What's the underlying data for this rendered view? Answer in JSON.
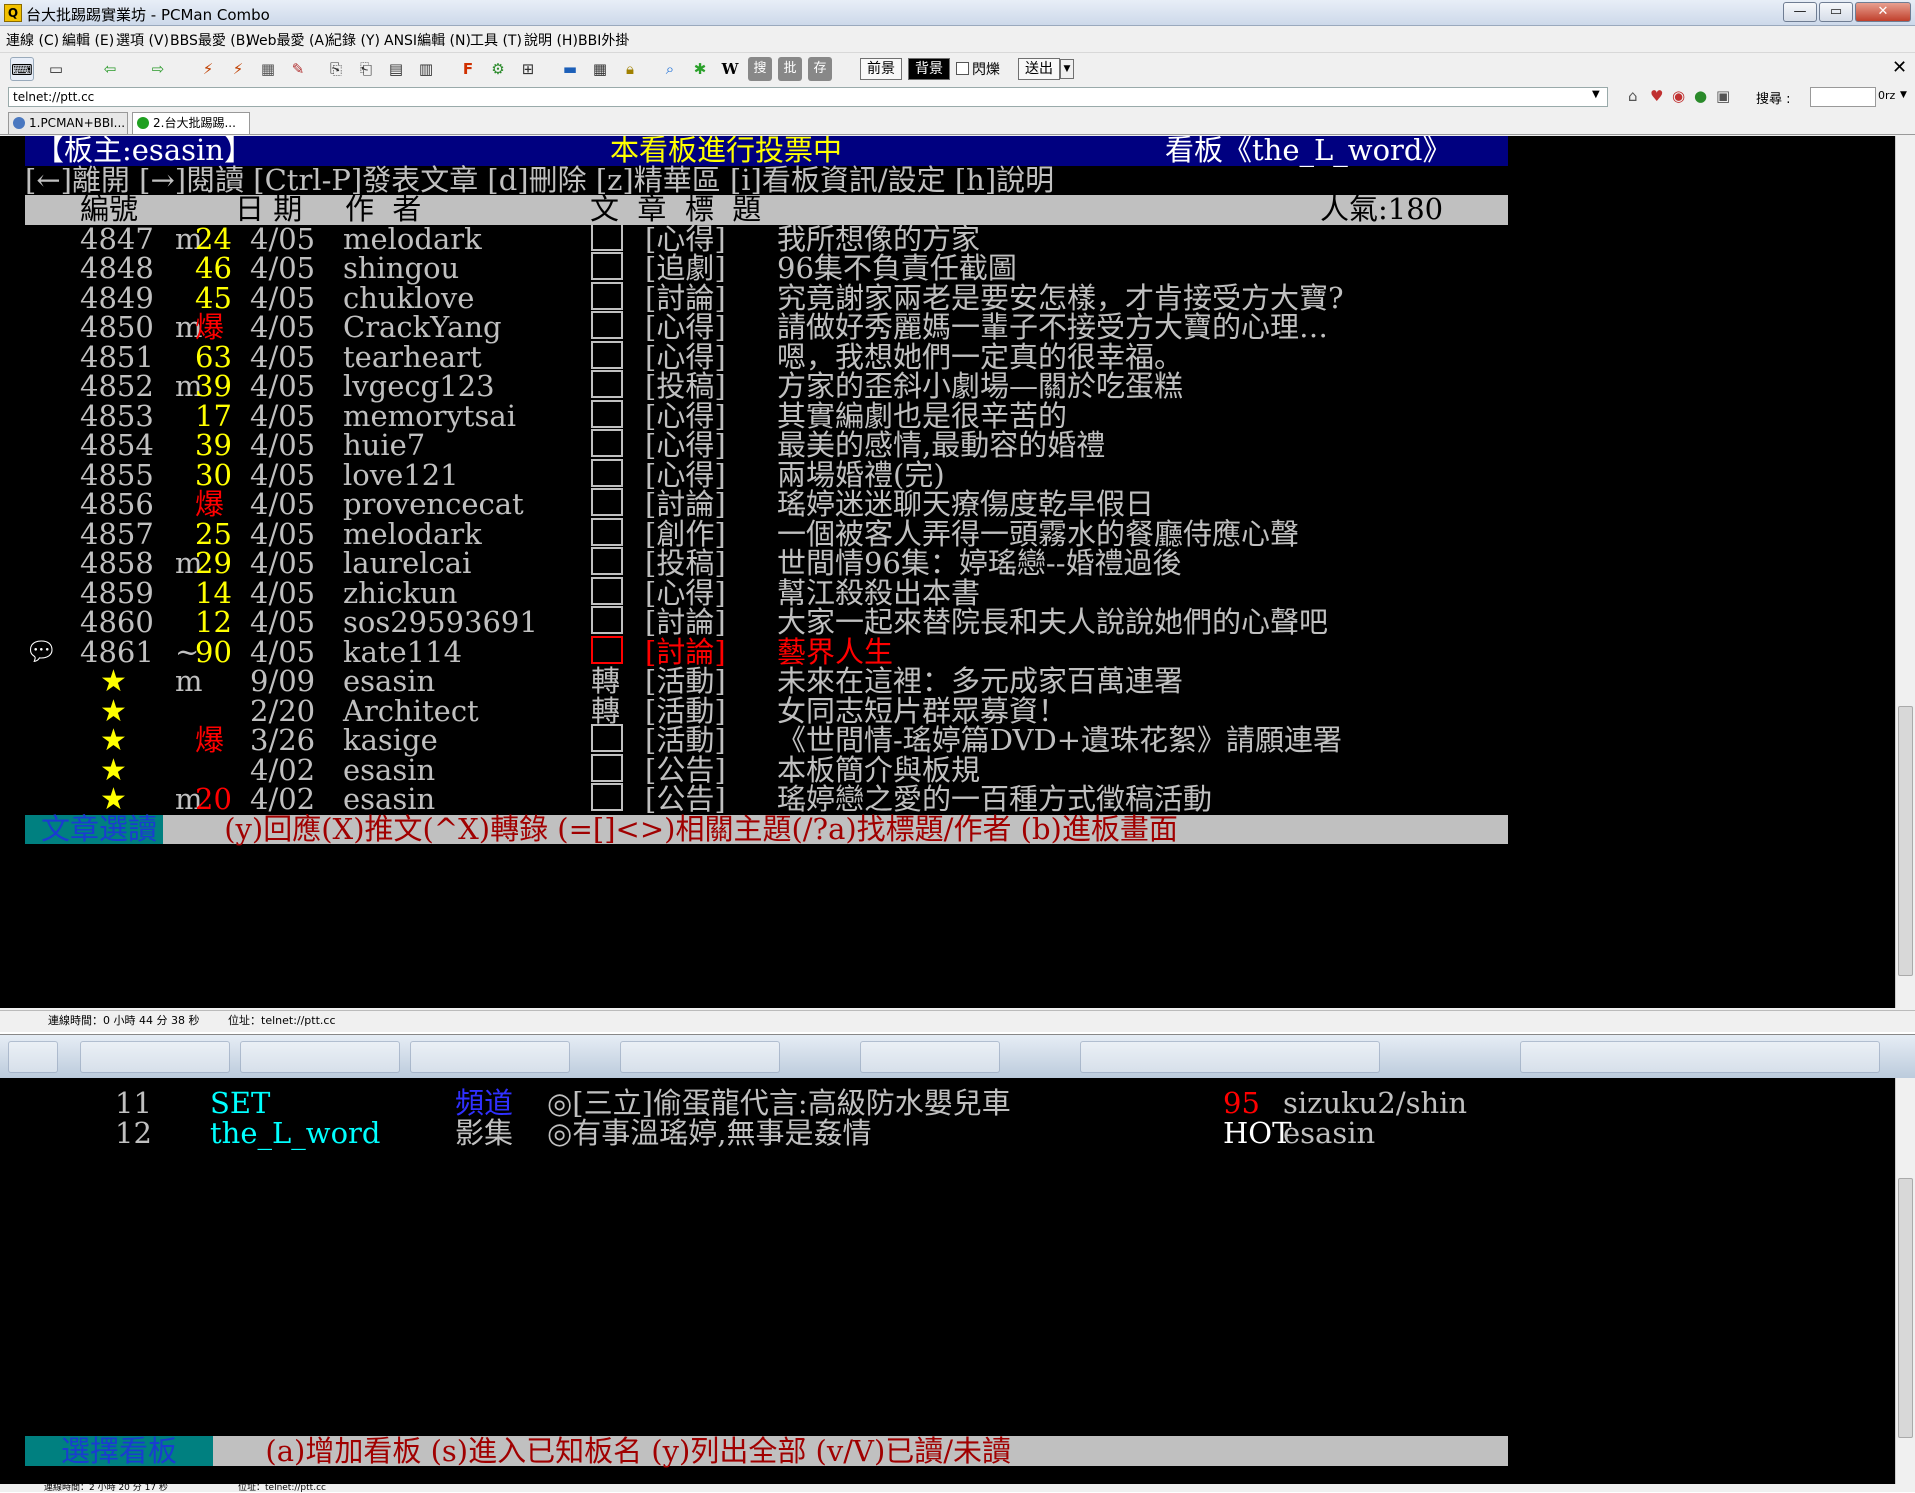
{
  "window": {
    "title": "台大批踢踢實業坊 - PCMan Combo",
    "icon_letter": "Q",
    "minimize": "—",
    "maximize": "▭",
    "close": "✕"
  },
  "menu": [
    "連線 (C)",
    "編輯 (E)",
    "選項 (V)",
    "BBS最愛 (B)",
    "Web最愛 (A)",
    "紀錄 (Y)",
    "ANSI編輯 (N)",
    "工具 (T)",
    "說明 (H)",
    "BBI外掛"
  ],
  "toolbar": {
    "fg_label": "前景",
    "bg_label": "背景",
    "blink_label": "閃爍",
    "send_label": "送出",
    "wiki_label": "W",
    "search_btn": "搜",
    "ptt_btn": "批",
    "save_btn": "存"
  },
  "address": {
    "url": "telnet://ptt.cc",
    "search_label": "搜尋 :",
    "search_value": "",
    "search_engine": "0rz"
  },
  "tabs": [
    {
      "label": "1.PCMAN+BBI...",
      "color": "#4a78c0"
    },
    {
      "label": "2.台大批踢踢...",
      "color": "#1fa020"
    }
  ],
  "board": {
    "header": {
      "moderator": "【板主:esasin】",
      "center": "本看板進行投票中",
      "board": "看板《the_L_word》"
    },
    "help": "[←]離開 [→]閱讀 [Ctrl-P]發表文章 [d]刪除 [z]精華區 [i]看板資訊/設定 [h]說明",
    "columns": {
      "num": "編號",
      "date": "日 期",
      "author": "作  者",
      "title": "文  章  標  題",
      "popularity": "人氣:180"
    },
    "posts": [
      {
        "num": "4847",
        "mark": "m",
        "score": "24",
        "date": "4/05",
        "author": "melodark",
        "flag": "box",
        "cat": "[心得]",
        "title": "我所想像的方家"
      },
      {
        "num": "4848",
        "mark": " ",
        "score": "46",
        "date": "4/05",
        "author": "shingou",
        "flag": "box",
        "cat": "[追劇]",
        "title": "96集不負責任截圖"
      },
      {
        "num": "4849",
        "mark": " ",
        "score": "45",
        "date": "4/05",
        "author": "chuklove",
        "flag": "box",
        "cat": "[討論]",
        "title": "究竟謝家兩老是要安怎樣，才肯接受方大寶?"
      },
      {
        "num": "4850",
        "mark": "m",
        "score": "爆",
        "date": "4/05",
        "author": "CrackYang",
        "flag": "box",
        "cat": "[心得]",
        "title": "請做好秀麗媽一輩子不接受方大寶的心理…"
      },
      {
        "num": "4851",
        "mark": " ",
        "score": "63",
        "date": "4/05",
        "author": "tearheart",
        "flag": "box",
        "cat": "[心得]",
        "title": "嗯，我想她們一定真的很幸福。"
      },
      {
        "num": "4852",
        "mark": "m",
        "score": "39",
        "date": "4/05",
        "author": "lvgecg123",
        "flag": "box",
        "cat": "[投稿]",
        "title": "方家的歪斜小劇場—關於吃蛋糕"
      },
      {
        "num": "4853",
        "mark": " ",
        "score": "17",
        "date": "4/05",
        "author": "memorytsai",
        "flag": "box",
        "cat": "[心得]",
        "title": "其實編劇也是很辛苦的"
      },
      {
        "num": "4854",
        "mark": " ",
        "score": "39",
        "date": "4/05",
        "author": "huie7",
        "flag": "box",
        "cat": "[心得]",
        "title": "最美的感情,最動容的婚禮"
      },
      {
        "num": "4855",
        "mark": " ",
        "score": "30",
        "date": "4/05",
        "author": "love121",
        "flag": "box",
        "cat": "[心得]",
        "title": "兩場婚禮(完)"
      },
      {
        "num": "4856",
        "mark": " ",
        "score": "爆",
        "date": "4/05",
        "author": "provencecat",
        "flag": "box",
        "cat": "[討論]",
        "title": "瑤婷迷迷聊天療傷度乾旱假日"
      },
      {
        "num": "4857",
        "mark": " ",
        "score": "25",
        "date": "4/05",
        "author": "melodark",
        "flag": "box",
        "cat": "[創作]",
        "title": "一個被客人弄得一頭霧水的餐廳侍應心聲"
      },
      {
        "num": "4858",
        "mark": "m",
        "score": "29",
        "date": "4/05",
        "author": "laurelcai",
        "flag": "box",
        "cat": "[投稿]",
        "title": "世間情96集：婷瑤戀--婚禮過後"
      },
      {
        "num": "4859",
        "mark": " ",
        "score": "14",
        "date": "4/05",
        "author": "zhickun",
        "flag": "box",
        "cat": "[心得]",
        "title": "幫江殺殺出本書"
      },
      {
        "num": "4860",
        "mark": " ",
        "score": "12",
        "date": "4/05",
        "author": "sos29593691",
        "flag": "box",
        "cat": "[討論]",
        "title": "大家一起來替院長和夫人說說她們的心聲吧"
      },
      {
        "num": "4861",
        "mark": "~",
        "score": "90",
        "date": "4/05",
        "author": "kate114",
        "flag": "box",
        "cat": "[討論]",
        "title": "藝界人生"
      }
    ],
    "pinned": [
      {
        "mark": "m",
        "score": "",
        "date": "9/09",
        "author": "esasin",
        "flag": "轉",
        "cat": "[活動]",
        "title": "未來在這裡：多元成家百萬連署"
      },
      {
        "mark": " ",
        "score": "",
        "date": "2/20",
        "author": "Architect",
        "flag": "轉",
        "cat": "[活動]",
        "title": "女同志短片群眾募資！"
      },
      {
        "mark": " ",
        "score": "爆",
        "date": "3/26",
        "author": "kasige",
        "flag": "box",
        "cat": "[活動]",
        "title": "《世間情-瑤婷篇DVD+遺珠花絮》請願連署"
      },
      {
        "mark": " ",
        "score": "",
        "date": "4/02",
        "author": "esasin",
        "flag": "box",
        "cat": "[公告]",
        "title": "本板簡介與板規"
      },
      {
        "mark": "m",
        "score": "20",
        "date": "4/02",
        "author": "esasin",
        "flag": "box",
        "cat": "[公告]",
        "title": "瑤婷戀之愛的一百種方式徵稿活動"
      }
    ],
    "star_char": "★",
    "footer_mode": "文章選讀",
    "footer_help": " (y)回應(X)推文(^X)轉錄 (=[]<>)相關主題(/?a)找標題/作者 (b)進板畫面"
  },
  "status1": {
    "connected": "連線時間：0 小時 44 分 38 秒",
    "address": "位址：telnet://ptt.cc"
  },
  "boardlist": {
    "rows": [
      {
        "num": "11",
        "name": "SET",
        "cls": "頻道",
        "desc": "◎[三立]偷蛋龍代言:高級防水嬰兒車",
        "pop": "95",
        "mods": "sizuku2/shin"
      },
      {
        "num": "12",
        "name": "the_L_word",
        "cls": "影集",
        "desc": "◎有事溫瑤婷,無事是姦情",
        "pop": "HOT",
        "mods": "esasin"
      }
    ],
    "footer_mode": "選擇看板",
    "footer_help": "  (a)增加看板 (s)進入已知板名 (y)列出全部 (v/V)已讀/未讀"
  },
  "status2": {
    "connected": "連線時間：2 小時 20 分 17 秒",
    "address": "位址：telnet://ptt.cc"
  },
  "colors": {
    "terminal_bg": "#000000",
    "header_bar": "#000080",
    "status_bar": "#c0c0c0",
    "footer_mode_bg": "#008080",
    "accent_yellow": "#ffff00",
    "accent_red": "#ff0000"
  }
}
